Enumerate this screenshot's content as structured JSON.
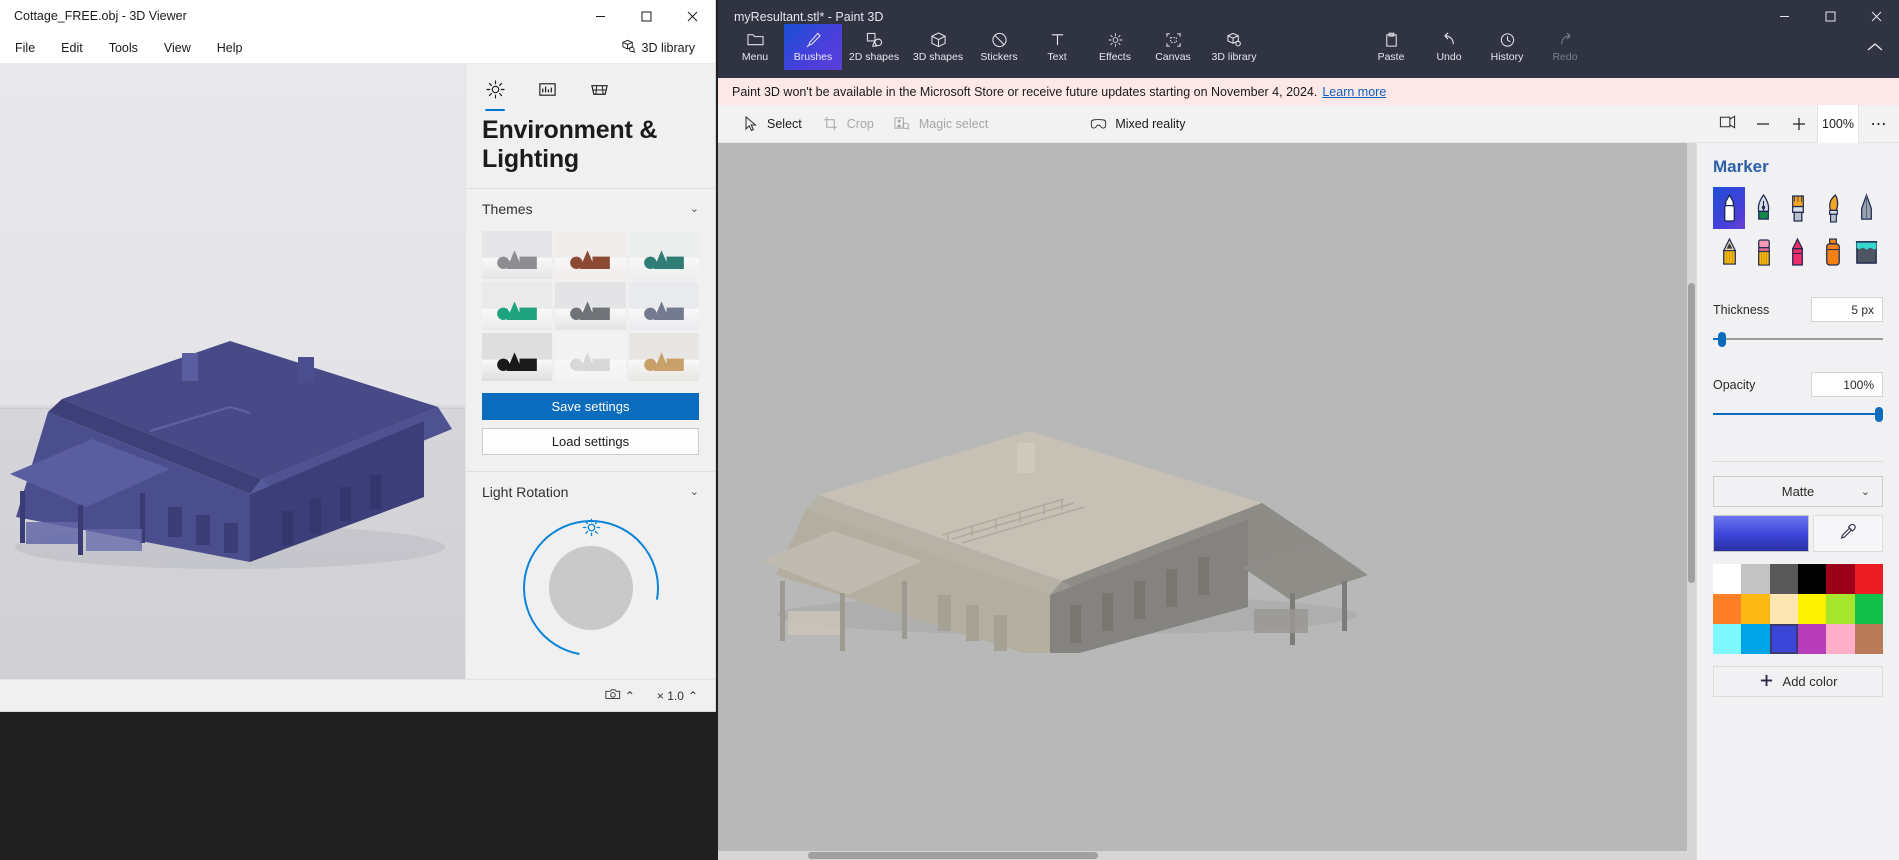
{
  "viewer": {
    "title": "Cottage_FREE.obj - 3D Viewer",
    "window_controls": {
      "minimize": "─",
      "maximize": "☐",
      "close": "✕"
    },
    "menu": [
      "File",
      "Edit",
      "Tools",
      "View",
      "Help"
    ],
    "library_button": "3D library",
    "panel": {
      "tabs": [
        {
          "name": "lighting-tab",
          "icon": "sun-icon",
          "active": true
        },
        {
          "name": "visual-effects-tab",
          "icon": "image-adjust-icon",
          "active": false
        },
        {
          "name": "grid-tab",
          "icon": "grid-icon",
          "active": false
        }
      ],
      "heading": "Environment & Lighting",
      "themes": {
        "label": "Themes",
        "chevron": "⌄",
        "cells": [
          {
            "bg": "#e6e6e8",
            "shape": "#8d8d92"
          },
          {
            "bg": "#f0ecea",
            "shape": "#8d4a33"
          },
          {
            "bg": "#eceeee",
            "shape": "#2f7d74"
          },
          {
            "bg": "#eaeaea",
            "shape": "#1fa37e"
          },
          {
            "bg": "#e4e4e6",
            "shape": "#6f7276"
          },
          {
            "bg": "#e9eaee",
            "shape": "#747a90"
          },
          {
            "bg": "#dedede",
            "shape": "#1a1a1a"
          },
          {
            "bg": "#f2f2f2",
            "shape": "#d8d8d8"
          },
          {
            "bg": "#e8e6e2",
            "shape": "#c8a06a"
          }
        ]
      },
      "save_settings": "Save settings",
      "load_settings": "Load settings",
      "light_rotation": {
        "label": "Light Rotation",
        "chevron": "⌄",
        "sun_icon": "sun-icon"
      }
    },
    "statusbar": {
      "camera_icon": "camera-icon",
      "chevron": "⌃",
      "scale_label": "× 1.0",
      "scale_chevron": "⌃"
    }
  },
  "paint": {
    "title": "myResultant.stl* - Paint 3D",
    "window_controls": {
      "minimize": "─",
      "maximize": "☐",
      "close": "✕"
    },
    "ribbon": [
      {
        "label": "Menu",
        "icon": "folder-icon",
        "state": "normal"
      },
      {
        "label": "Brushes",
        "icon": "brush-icon",
        "state": "active"
      },
      {
        "label": "2D shapes",
        "icon": "shapes-2d-icon",
        "state": "normal"
      },
      {
        "label": "3D shapes",
        "icon": "cube-icon",
        "state": "normal"
      },
      {
        "label": "Stickers",
        "icon": "sticker-icon",
        "state": "normal"
      },
      {
        "label": "Text",
        "icon": "text-icon",
        "state": "normal"
      },
      {
        "label": "Effects",
        "icon": "effects-icon",
        "state": "normal"
      },
      {
        "label": "Canvas",
        "icon": "canvas-icon",
        "state": "normal"
      },
      {
        "label": "3D library",
        "icon": "library-icon",
        "state": "normal"
      },
      {
        "label": "Paste",
        "icon": "clipboard-icon",
        "state": "normal"
      },
      {
        "label": "Undo",
        "icon": "undo-icon",
        "state": "normal"
      },
      {
        "label": "History",
        "icon": "history-icon",
        "state": "normal"
      },
      {
        "label": "Redo",
        "icon": "redo-icon",
        "state": "disabled"
      }
    ],
    "ribbon_collapse": "⌃",
    "notification": {
      "text": "Paint 3D won't be available in the Microsoft Store or receive future updates starting on November 4, 2024.",
      "link": "Learn more"
    },
    "subbar": {
      "items": [
        {
          "label": "Select",
          "icon": "cursor-icon",
          "state": "normal"
        },
        {
          "label": "Crop",
          "icon": "crop-icon",
          "state": "disabled"
        },
        {
          "label": "Magic select",
          "icon": "magic-select-icon",
          "state": "disabled"
        },
        {
          "label": "Mixed reality",
          "icon": "mixed-reality-icon",
          "state": "normal"
        }
      ],
      "view_icon": "view-3d-icon",
      "zoom_out": "−",
      "zoom_in": "+",
      "zoom_value": "100%",
      "more": "⋯"
    },
    "tool_panel": {
      "title": "Marker",
      "brushes": [
        {
          "name": "marker",
          "icon": "marker-icon",
          "selected": true
        },
        {
          "name": "calligraphy-pen",
          "icon": "calligraphy-pen-icon",
          "selected": false
        },
        {
          "name": "oil-brush",
          "icon": "oil-brush-icon",
          "selected": false
        },
        {
          "name": "watercolor",
          "icon": "watercolor-brush-icon",
          "selected": false
        },
        {
          "name": "pixel-pen",
          "icon": "pixel-pen-icon",
          "selected": false
        },
        {
          "name": "pencil",
          "icon": "pencil-icon",
          "selected": false
        },
        {
          "name": "eraser",
          "icon": "eraser-icon",
          "selected": false
        },
        {
          "name": "crayon",
          "icon": "crayon-icon",
          "selected": false
        },
        {
          "name": "spray-can",
          "icon": "spray-can-icon",
          "selected": false
        },
        {
          "name": "fill",
          "icon": "fill-bucket-icon",
          "selected": false
        }
      ],
      "thickness": {
        "label": "Thickness",
        "value": "5 px",
        "percent": 4
      },
      "opacity": {
        "label": "Opacity",
        "value": "100%",
        "percent": 100
      },
      "material": {
        "value": "Matte",
        "chevron": "⌄"
      },
      "current_color": "#3b45d8",
      "eyedropper_icon": "eyedropper-icon",
      "swatches": [
        {
          "hex": "#ffffff",
          "selected": false
        },
        {
          "hex": "#c3c3c3",
          "selected": false
        },
        {
          "hex": "#585858",
          "selected": false
        },
        {
          "hex": "#000000",
          "selected": false
        },
        {
          "hex": "#9c0019",
          "selected": false
        },
        {
          "hex": "#ed1c24",
          "selected": false
        },
        {
          "hex": "#ff7f27",
          "selected": false
        },
        {
          "hex": "#fdb913",
          "selected": false
        },
        {
          "hex": "#fce7b2",
          "selected": false
        },
        {
          "hex": "#fff200",
          "selected": false
        },
        {
          "hex": "#a5e52d",
          "selected": false
        },
        {
          "hex": "#12c04a",
          "selected": false
        },
        {
          "hex": "#7ef9ff",
          "selected": false
        },
        {
          "hex": "#00a2e8",
          "selected": false
        },
        {
          "hex": "#3b45d8",
          "selected": true
        },
        {
          "hex": "#b83dba",
          "selected": false
        },
        {
          "hex": "#ffaec9",
          "selected": false
        },
        {
          "hex": "#b97a57",
          "selected": false
        }
      ],
      "add_color": {
        "label": "Add color",
        "icon": "plus-icon"
      }
    }
  }
}
